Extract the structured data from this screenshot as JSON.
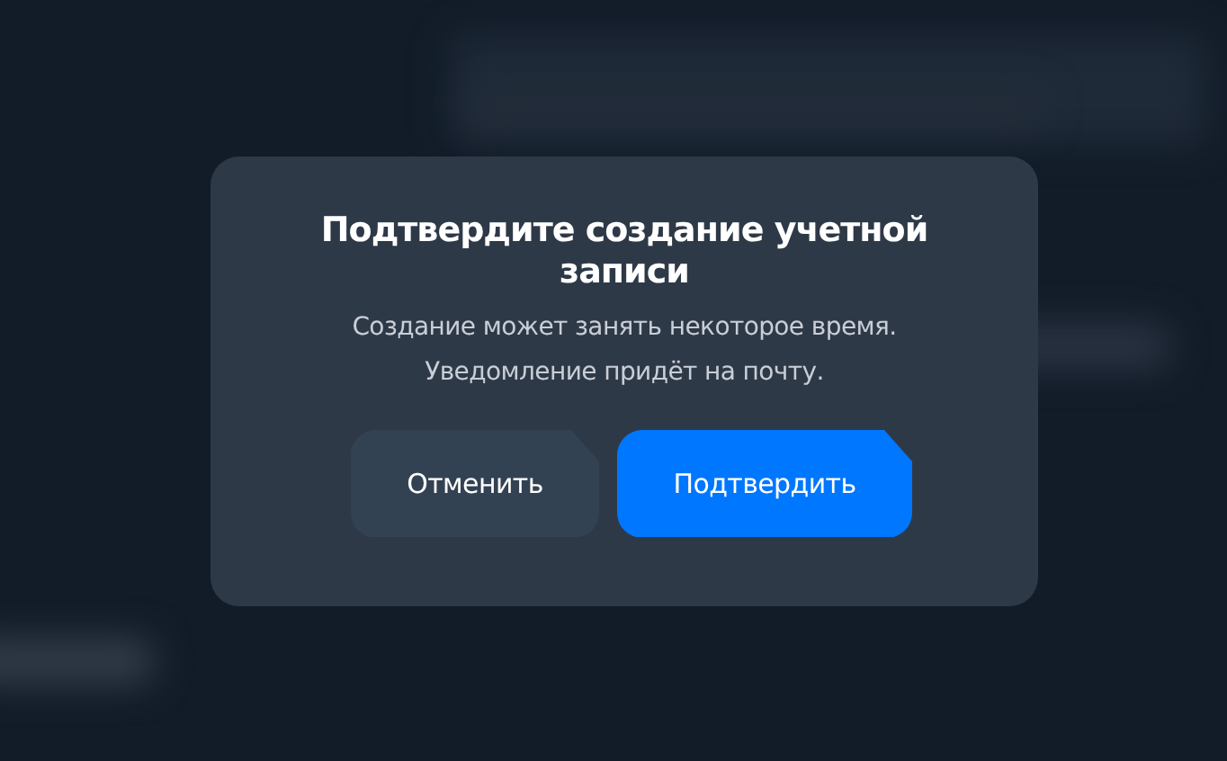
{
  "dialog": {
    "title": "Подтвердите создание учетной записи",
    "message_lines": [
      "Создание может занять некоторое время.",
      "Уведомление придёт на почту."
    ],
    "buttons": [
      {
        "label": "Отменить",
        "kind": "secondary"
      },
      {
        "label": "Подтвердить",
        "kind": "primary"
      }
    ]
  }
}
